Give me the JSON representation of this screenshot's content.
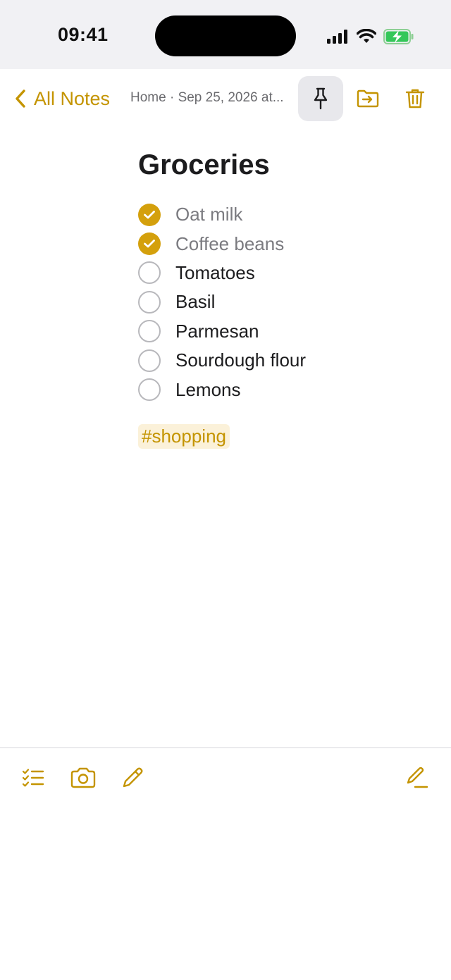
{
  "status_bar": {
    "time": "09:41",
    "icons": [
      "cellular-signal-icon",
      "wifi-icon",
      "battery-charging-icon"
    ]
  },
  "nav": {
    "back_label": "All Notes",
    "meta": "Home · Sep 25, 2026 at...",
    "pin_icon": "pin-icon",
    "move_icon": "folder-move-icon",
    "delete_icon": "trash-icon"
  },
  "note": {
    "title": "Groceries",
    "items": [
      {
        "label": "Oat milk",
        "checked": true
      },
      {
        "label": "Coffee beans",
        "checked": true
      },
      {
        "label": "Tomatoes",
        "checked": false
      },
      {
        "label": "Basil",
        "checked": false
      },
      {
        "label": "Parmesan",
        "checked": false
      },
      {
        "label": "Sourdough flour",
        "checked": false
      },
      {
        "label": "Lemons",
        "checked": false
      }
    ],
    "tag": "#shopping"
  },
  "toolbar": {
    "icons": [
      "checklist-icon",
      "camera-icon",
      "markup-pen-icon",
      "compose-icon"
    ]
  },
  "colors": {
    "accent": "#c49400",
    "check_fill": "#d4a00c",
    "tag_bg": "#fbf1d9"
  }
}
